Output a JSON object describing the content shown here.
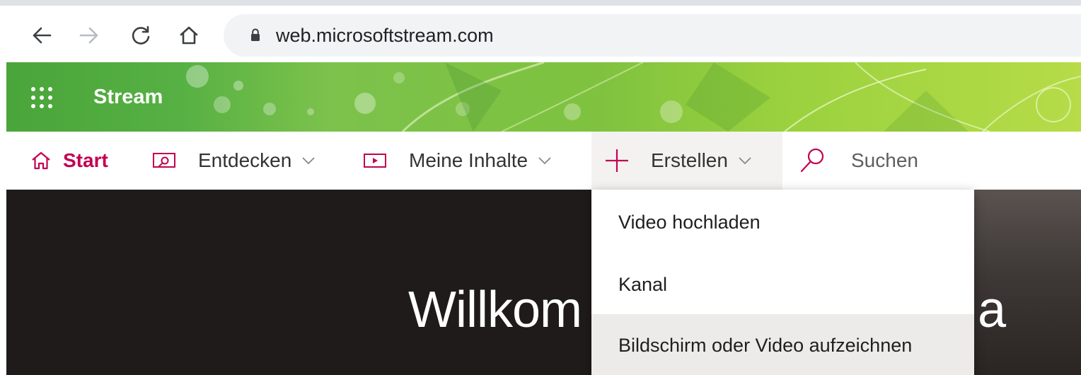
{
  "browser": {
    "url": "web.microsoftstream.com",
    "icons": [
      "back-icon",
      "forward-icon",
      "reload-icon",
      "home-icon",
      "lock-icon"
    ]
  },
  "header": {
    "app_name": "Stream",
    "accent_color": "#5fb446"
  },
  "nav": {
    "start": "Start",
    "discover": "Entdecken",
    "my_content": "Meine Inhalte",
    "create": "Erstellen",
    "search_placeholder": "Suchen",
    "accent_color": "#c30052"
  },
  "hero": {
    "title_visible": "Willkom",
    "title_tail": "a"
  },
  "create_menu": {
    "items": [
      "Video hochladen",
      "Kanal",
      "Bildschirm oder Video aufzeichnen"
    ]
  }
}
